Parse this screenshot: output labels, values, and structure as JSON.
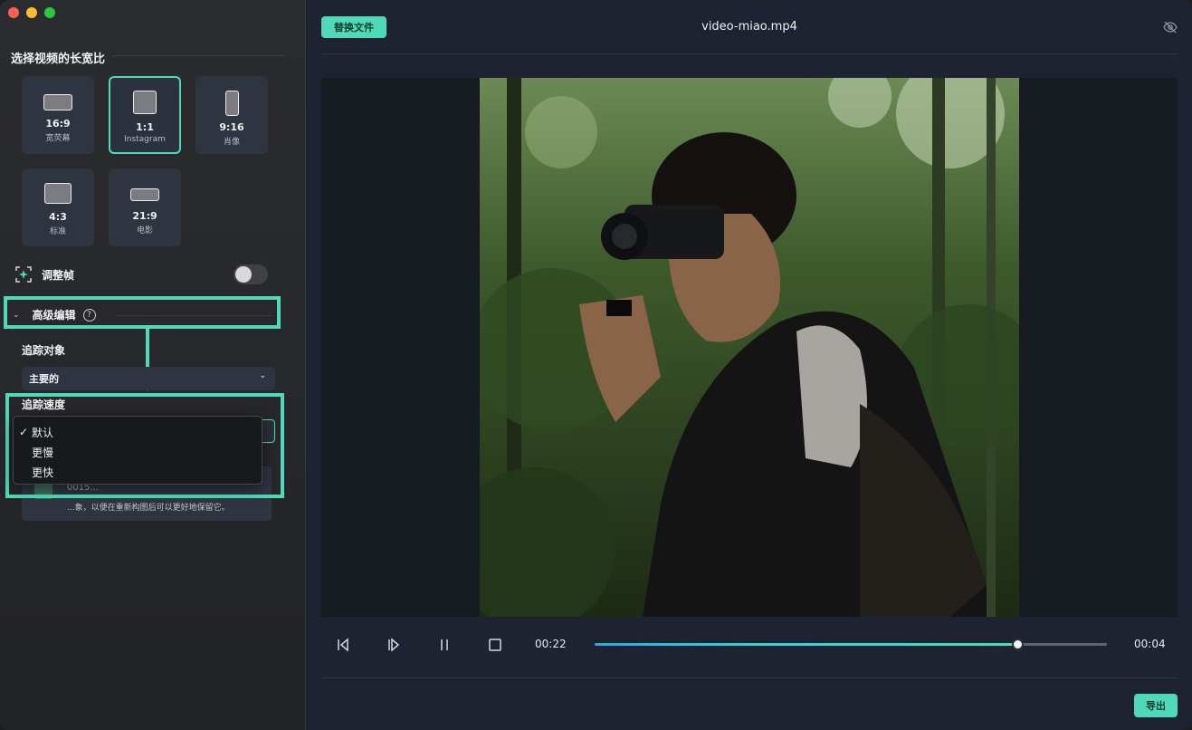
{
  "window": {
    "controls": [
      "close",
      "minimize",
      "zoom"
    ]
  },
  "sidebar": {
    "aspect_title": "选择视频的长宽比",
    "aspect_options": [
      {
        "ratio": "16:9",
        "label": "宽荧幕",
        "selected": false
      },
      {
        "ratio": "1:1",
        "label": "Instagram",
        "selected": true
      },
      {
        "ratio": "9:16",
        "label": "肖像",
        "selected": false
      },
      {
        "ratio": "4:3",
        "label": "标准",
        "selected": false
      },
      {
        "ratio": "21:9",
        "label": "电影",
        "selected": false
      }
    ],
    "adjust_frame": {
      "label": "调整帧",
      "enabled": false
    },
    "advanced": {
      "label": "高级编辑",
      "help": "?",
      "expanded": true
    },
    "track_target": {
      "label": "追踪对象",
      "value": "主要的"
    },
    "track_speed": {
      "label": "追踪速度",
      "options": [
        "默认",
        "更慢",
        "更快"
      ],
      "selected": "默认"
    },
    "info_card": {
      "title": "0015...",
      "description": "...象，以便在重新构图后可以更好地保留它。"
    }
  },
  "main": {
    "replace_label": "替换文件",
    "file_name": "video-miao.mp4",
    "player": {
      "current_time": "00:22",
      "remaining_time": "00:04",
      "progress_fraction": 0.825
    },
    "export_label": "导出"
  },
  "colors": {
    "accent": "#4fd9b6",
    "progress_start": "#2fa7e8"
  }
}
